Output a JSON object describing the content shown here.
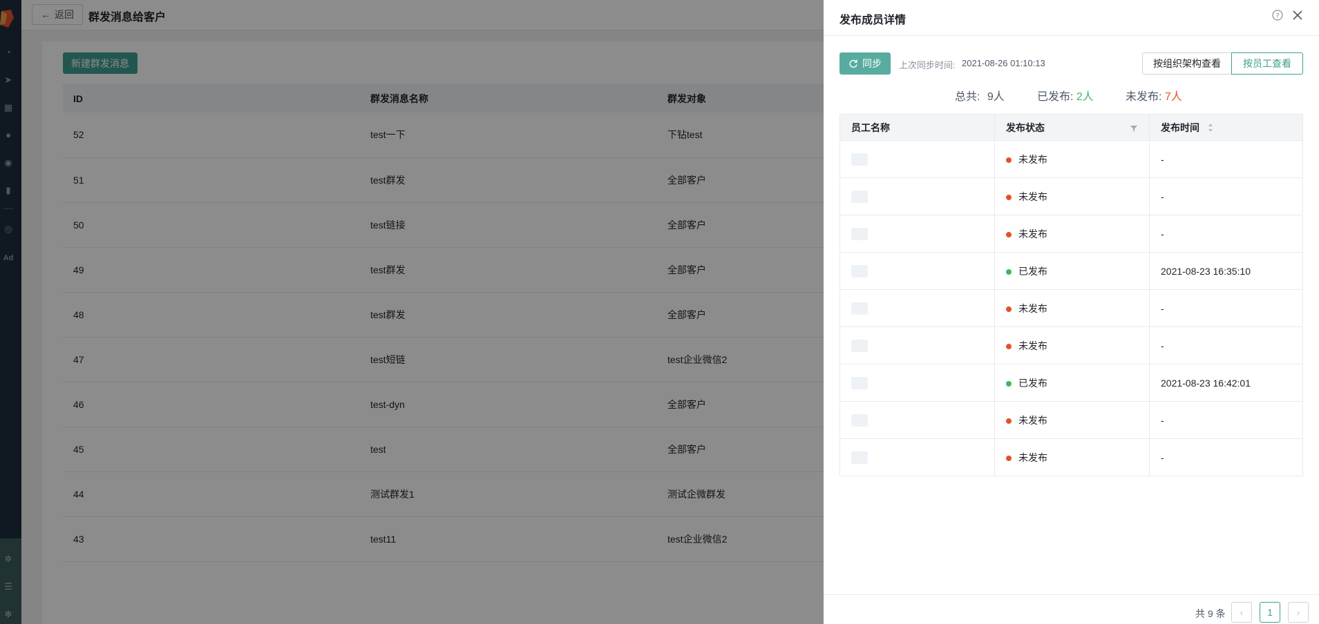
{
  "header": {
    "back_label": "返回",
    "title": "群发消息给客户"
  },
  "toolbar": {
    "new_label": "新建群发消息"
  },
  "list": {
    "columns": [
      "ID",
      "群发消息名称",
      "群发对象"
    ],
    "rows": [
      {
        "id": "52",
        "name": "test一下",
        "target": "下钻test"
      },
      {
        "id": "51",
        "name": "test群发",
        "target": "全部客户"
      },
      {
        "id": "50",
        "name": "test链接",
        "target": "全部客户"
      },
      {
        "id": "49",
        "name": "test群发",
        "target": "全部客户"
      },
      {
        "id": "48",
        "name": "test群发",
        "target": "全部客户"
      },
      {
        "id": "47",
        "name": "test短链",
        "target": "test企业微信2"
      },
      {
        "id": "46",
        "name": "test-dyn",
        "target": "全部客户"
      },
      {
        "id": "45",
        "name": "test",
        "target": "全部客户"
      },
      {
        "id": "44",
        "name": "测试群发1",
        "target": "测试企微群发"
      },
      {
        "id": "43",
        "name": "test11",
        "target": "test企业微信2"
      }
    ]
  },
  "drawer": {
    "title": "发布成员详情",
    "sync_label": "同步",
    "last_sync_label": "上次同步时间:",
    "last_sync_time": "2021-08-26 01:10:13",
    "view_by_org": "按组织架构查看",
    "view_by_employee": "按员工查看",
    "summary": {
      "total_label": "总共:",
      "total_value": "9人",
      "published_label": "已发布:",
      "published_value": "2人",
      "unpublished_label": "未发布:",
      "unpublished_value": "7人"
    },
    "columns": [
      "员工名称",
      "发布状态",
      "发布时间"
    ],
    "members": [
      {
        "status": "未发布",
        "time": "-"
      },
      {
        "status": "未发布",
        "time": "-"
      },
      {
        "status": "未发布",
        "time": "-"
      },
      {
        "status": "已发布",
        "time": "2021-08-23 16:35:10"
      },
      {
        "status": "未发布",
        "time": "-"
      },
      {
        "status": "未发布",
        "time": "-"
      },
      {
        "status": "已发布",
        "time": "2021-08-23 16:42:01"
      },
      {
        "status": "未发布",
        "time": "-"
      },
      {
        "status": "未发布",
        "time": "-"
      }
    ],
    "pagination": {
      "total_text": "共 9 条",
      "current_page": "1"
    }
  },
  "colors": {
    "accent": "#3e9e90",
    "published": "#3db85b",
    "unpublished": "#e5502e",
    "sidebar": "#1e2c3c"
  }
}
